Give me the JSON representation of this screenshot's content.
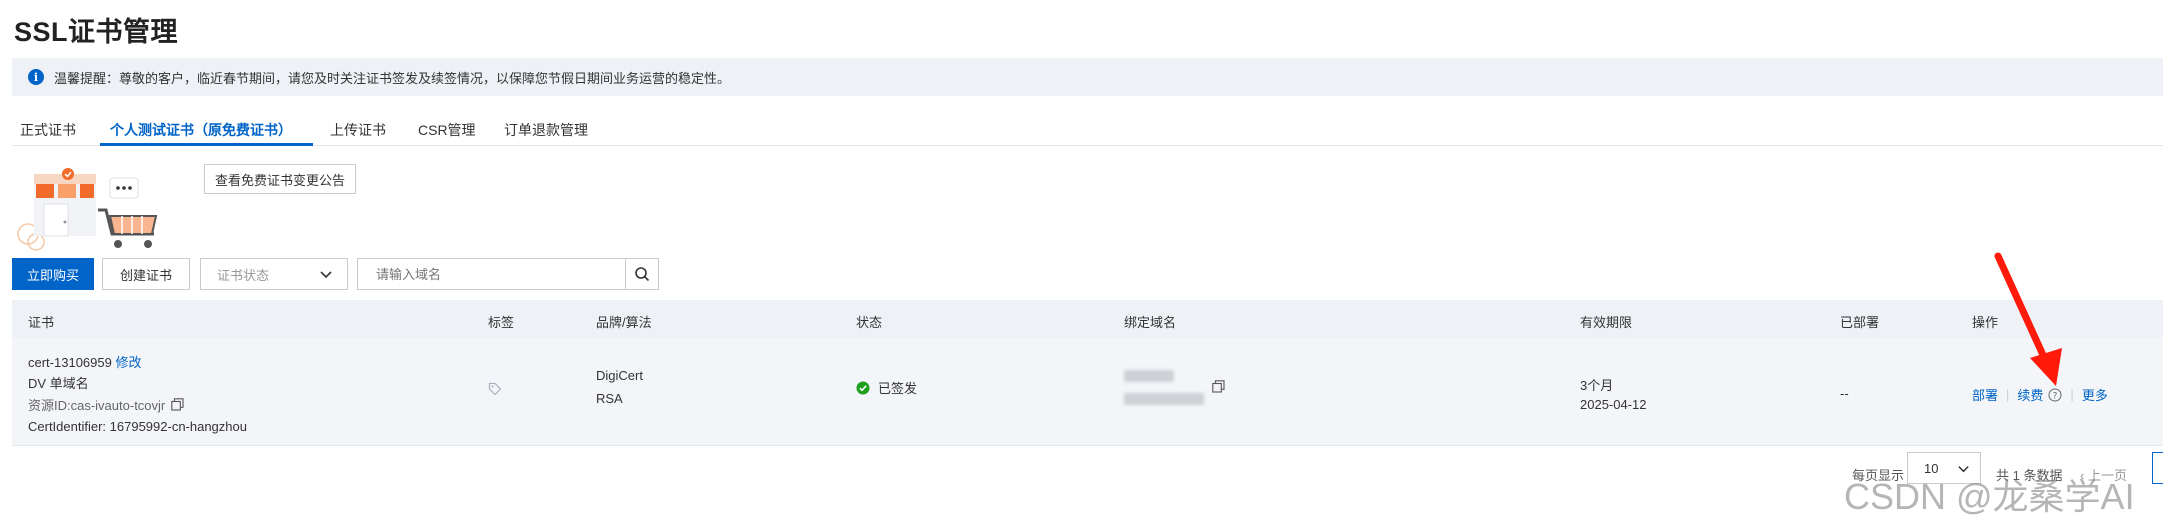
{
  "page": {
    "title": "SSL证书管理"
  },
  "notice": {
    "text": "温馨提醒：尊敬的客户，临近春节期间，请您及时关注证书签发及续签情况，以保障您节假日期间业务运营的稳定性。"
  },
  "tabs": [
    {
      "label": "正式证书"
    },
    {
      "label": "个人测试证书（原免费证书）"
    },
    {
      "label": "上传证书"
    },
    {
      "label": "CSR管理"
    },
    {
      "label": "订单退款管理"
    }
  ],
  "announcement_button": "查看免费证书变更公告",
  "toolbar": {
    "buy_label": "立即购买",
    "create_label": "创建证书",
    "status_placeholder": "证书状态",
    "search_placeholder": "请输入域名"
  },
  "table": {
    "headers": {
      "cert": "证书",
      "tag": "标签",
      "brand": "品牌/算法",
      "status": "状态",
      "domain": "绑定域名",
      "validity": "有效期限",
      "deployed": "已部署",
      "actions": "操作"
    },
    "row": {
      "cert_id": "cert-13106959",
      "modify_label": "修改",
      "type": "DV 单域名",
      "resource_id": "资源ID:cas-ivauto-tcovjr",
      "identifier": "CertIdentifier: 16795992-cn-hangzhou",
      "brand": "DigiCert",
      "algorithm": "RSA",
      "status": "已签发",
      "validity_period": "3个月",
      "expiry": "2025-04-12",
      "deployed": "--",
      "action_deploy": "部署",
      "action_renew": "续费",
      "action_more": "更多"
    }
  },
  "pagination": {
    "per_page_label": "每页显示",
    "page_size": "10",
    "total": "共 1 条数据",
    "prev_label": "上一页"
  },
  "watermark": "CSDN @龙桑学AI",
  "colors": {
    "primary": "#0064c8",
    "success": "#1ea01e",
    "annotation_arrow": "#ff1a0a"
  }
}
